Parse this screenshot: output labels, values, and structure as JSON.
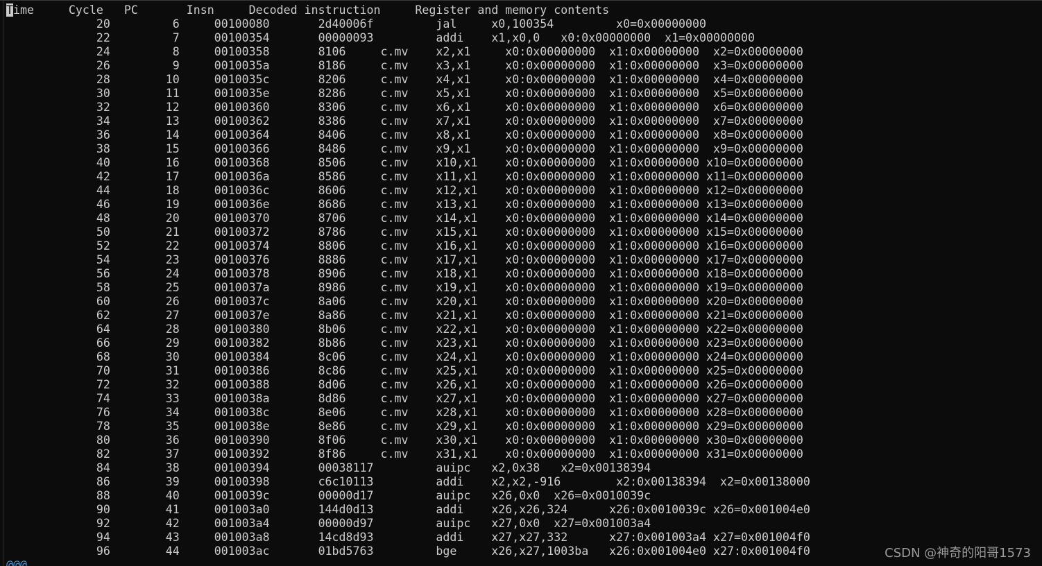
{
  "terminal": {
    "cursor_char": "T",
    "header_rest": "ime     Cycle   PC       Insn     Decoded instruction     Register and memory contents",
    "lines": [
      "             20         6     00100080       2d40006f         jal     x0,100354         x0=0x00000000",
      "             22         7     00100354       00000093         addi    x1,x0,0   x0:0x00000000  x1=0x00000000",
      "             24         8     00100358       8106     c.mv    x2,x1     x0:0x00000000  x1:0x00000000  x2=0x00000000",
      "             26         9     0010035a       8186     c.mv    x3,x1     x0:0x00000000  x1:0x00000000  x3=0x00000000",
      "             28        10     0010035c       8206     c.mv    x4,x1     x0:0x00000000  x1:0x00000000  x4=0x00000000",
      "             30        11     0010035e       8286     c.mv    x5,x1     x0:0x00000000  x1:0x00000000  x5=0x00000000",
      "             32        12     00100360       8306     c.mv    x6,x1     x0:0x00000000  x1:0x00000000  x6=0x00000000",
      "             34        13     00100362       8386     c.mv    x7,x1     x0:0x00000000  x1:0x00000000  x7=0x00000000",
      "             36        14     00100364       8406     c.mv    x8,x1     x0:0x00000000  x1:0x00000000  x8=0x00000000",
      "             38        15     00100366       8486     c.mv    x9,x1     x0:0x00000000  x1:0x00000000  x9=0x00000000",
      "             40        16     00100368       8506     c.mv    x10,x1    x0:0x00000000  x1:0x00000000 x10=0x00000000",
      "             42        17     0010036a       8586     c.mv    x11,x1    x0:0x00000000  x1:0x00000000 x11=0x00000000",
      "             44        18     0010036c       8606     c.mv    x12,x1    x0:0x00000000  x1:0x00000000 x12=0x00000000",
      "             46        19     0010036e       8686     c.mv    x13,x1    x0:0x00000000  x1:0x00000000 x13=0x00000000",
      "             48        20     00100370       8706     c.mv    x14,x1    x0:0x00000000  x1:0x00000000 x14=0x00000000",
      "             50        21     00100372       8786     c.mv    x15,x1    x0:0x00000000  x1:0x00000000 x15=0x00000000",
      "             52        22     00100374       8806     c.mv    x16,x1    x0:0x00000000  x1:0x00000000 x16=0x00000000",
      "             54        23     00100376       8886     c.mv    x17,x1    x0:0x00000000  x1:0x00000000 x17=0x00000000",
      "             56        24     00100378       8906     c.mv    x18,x1    x0:0x00000000  x1:0x00000000 x18=0x00000000",
      "             58        25     0010037a       8986     c.mv    x19,x1    x0:0x00000000  x1:0x00000000 x19=0x00000000",
      "             60        26     0010037c       8a06     c.mv    x20,x1    x0:0x00000000  x1:0x00000000 x20=0x00000000",
      "             62        27     0010037e       8a86     c.mv    x21,x1    x0:0x00000000  x1:0x00000000 x21=0x00000000",
      "             64        28     00100380       8b06     c.mv    x22,x1    x0:0x00000000  x1:0x00000000 x22=0x00000000",
      "             66        29     00100382       8b86     c.mv    x23,x1    x0:0x00000000  x1:0x00000000 x23=0x00000000",
      "             68        30     00100384       8c06     c.mv    x24,x1    x0:0x00000000  x1:0x00000000 x24=0x00000000",
      "             70        31     00100386       8c86     c.mv    x25,x1    x0:0x00000000  x1:0x00000000 x25=0x00000000",
      "             72        32     00100388       8d06     c.mv    x26,x1    x0:0x00000000  x1:0x00000000 x26=0x00000000",
      "             74        33     0010038a       8d86     c.mv    x27,x1    x0:0x00000000  x1:0x00000000 x27=0x00000000",
      "             76        34     0010038c       8e06     c.mv    x28,x1    x0:0x00000000  x1:0x00000000 x28=0x00000000",
      "             78        35     0010038e       8e86     c.mv    x29,x1    x0:0x00000000  x1:0x00000000 x29=0x00000000",
      "             80        36     00100390       8f06     c.mv    x30,x1    x0:0x00000000  x1:0x00000000 x30=0x00000000",
      "             82        37     00100392       8f86     c.mv    x31,x1    x0:0x00000000  x1:0x00000000 x31=0x00000000",
      "             84        38     00100394       00038117         auipc   x2,0x38   x2=0x00138394",
      "             86        39     00100398       c6c10113         addi    x2,x2,-916        x2:0x00138394  x2=0x00138000",
      "             88        40     0010039c       00000d17         auipc   x26,0x0  x26=0x0010039c",
      "             90        41     001003a0       144d0d13         addi    x26,x26,324      x26:0x0010039c x26=0x001004e0",
      "             92        42     001003a4       00000d97         auipc   x27,0x0  x27=0x001003a4",
      "             94        43     001003a8       14cd8d93         addi    x27,x27,332      x27:0x001003a4 x27=0x001004f0",
      "             96        44     001003ac       01bd5763         bge     x26,x27,1003ba   x26:0x001004e0 x27:0x001004f0"
    ],
    "tilde_line": "@@@"
  },
  "watermark": "CSDN @神奇的阳哥1573",
  "colors": {
    "background": "#0c0c0c",
    "text": "#cccccc",
    "tilde": "#3a96dd",
    "watermark": "#9a9a9a"
  }
}
